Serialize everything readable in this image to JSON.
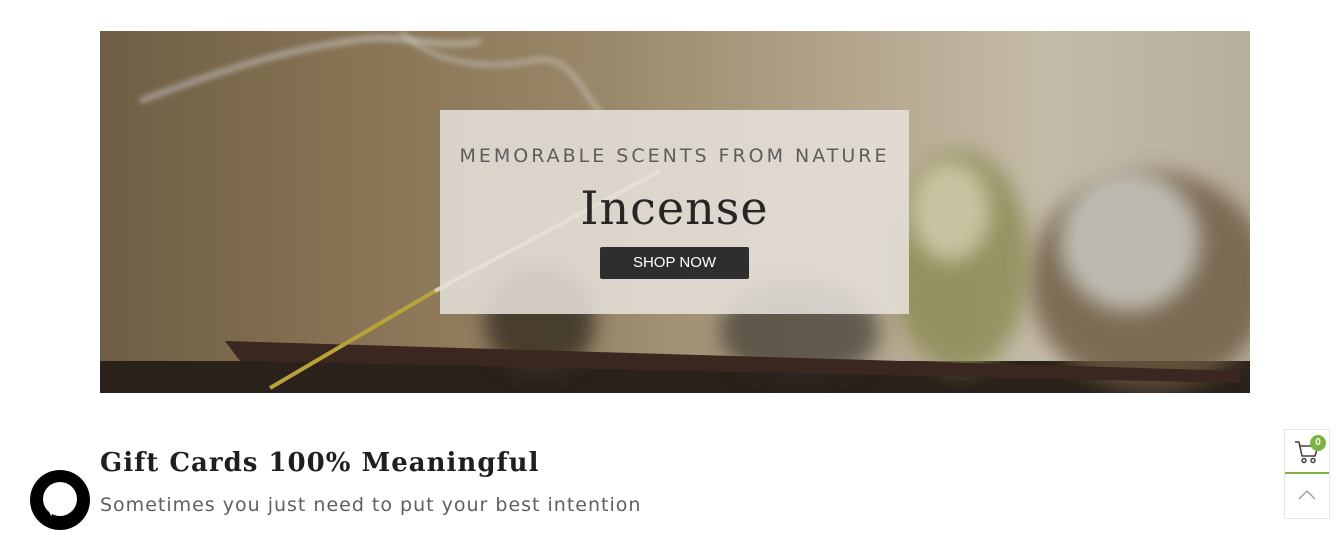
{
  "hero": {
    "kicker": "MEMORABLE SCENTS FROM NATURE",
    "title": "Incense",
    "cta_label": "SHOP NOW"
  },
  "gift_cards": {
    "title": "Gift Cards 100% Meaningful",
    "subtitle": "Sometimes you just need to put your best intention"
  },
  "cart": {
    "count": "0",
    "icon": "cart-icon"
  },
  "scroll_top": {
    "icon": "chevron-up-icon"
  },
  "chat": {
    "icon": "chat-bubble-icon"
  },
  "colors": {
    "accent": "#7cb342",
    "button_dark": "#2e2e2e",
    "text_dark": "#1f1f1f",
    "text_muted": "#5f5f5f"
  }
}
